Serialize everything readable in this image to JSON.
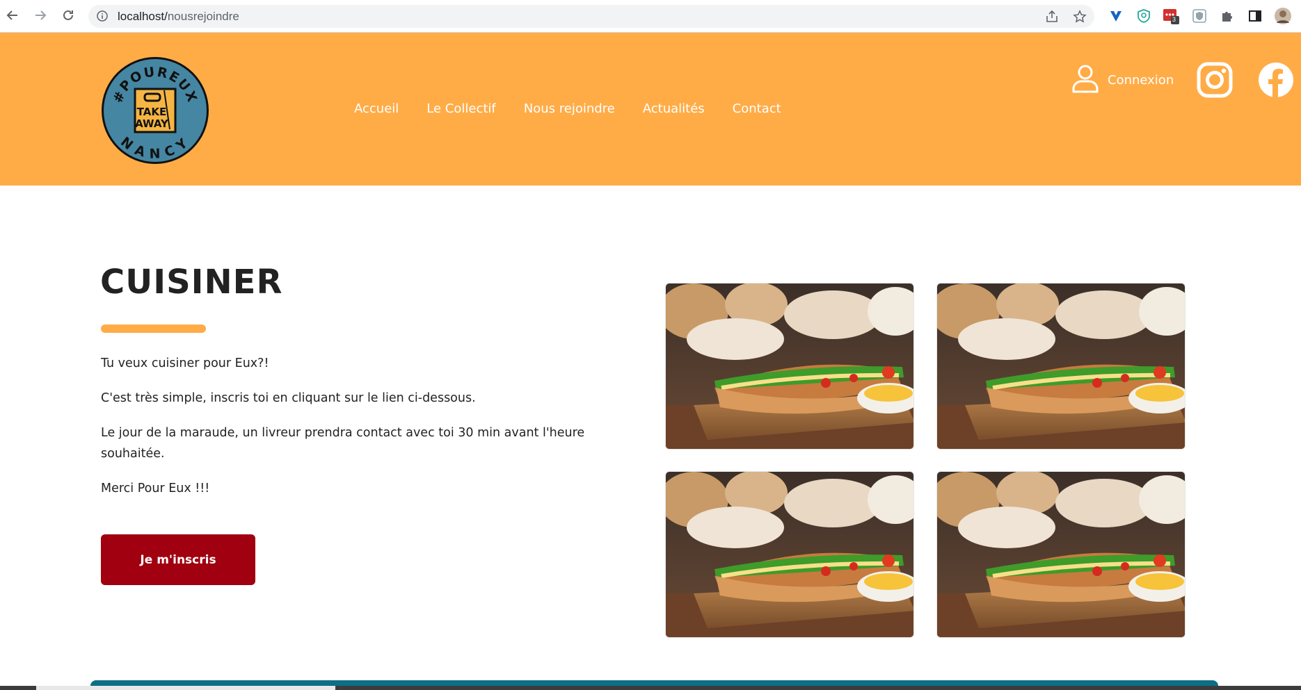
{
  "browser": {
    "url_host": "localhost/",
    "url_path": "nousrejoindre",
    "extension_badge": "3"
  },
  "header": {
    "logo": {
      "ring_text_top": "#POUREUX",
      "ring_text_bottom": "NANCY",
      "bag_line1": "TAKE",
      "bag_line2": "AWAY"
    },
    "nav": [
      {
        "label": "Accueil"
      },
      {
        "label": "Le Collectif"
      },
      {
        "label": "Nous rejoindre"
      },
      {
        "label": "Actualités"
      },
      {
        "label": "Contact"
      }
    ],
    "login_label": "Connexion",
    "colors": {
      "header_bg": "#ffac47",
      "cta_bg": "#a0000f",
      "footer": "#0e6e86"
    }
  },
  "main": {
    "title": "CUISINER",
    "paragraphs": [
      "Tu veux cuisiner pour Eux?!",
      "C'est très simple, inscris toi en cliquant sur le lien ci-dessous.",
      "Le jour de la maraude, un livreur prendra contact avec toi 30 min avant l'heure souhaitée.",
      "Merci Pour Eux !!!"
    ],
    "cta_label": "Je m'inscris"
  },
  "icons": [
    "back-icon",
    "forward-icon",
    "reload-icon",
    "info-icon",
    "share-icon",
    "star-icon",
    "puzzle-icon",
    "user-icon",
    "instagram-icon",
    "facebook-icon"
  ]
}
